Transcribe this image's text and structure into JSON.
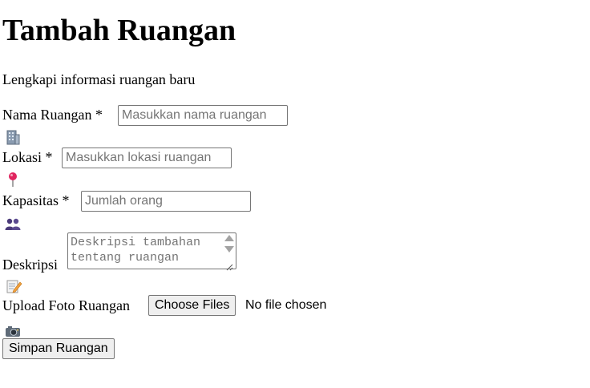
{
  "page": {
    "title": "Tambah Ruangan",
    "subtitle": "Lengkapi informasi ruangan baru"
  },
  "form": {
    "name": {
      "label": "Nama Ruangan *",
      "placeholder": "Masukkan nama ruangan",
      "value": "",
      "icon": "building-icon"
    },
    "location": {
      "label": "Lokasi *",
      "placeholder": "Masukkan lokasi ruangan",
      "value": "",
      "icon": "map-pin-icon"
    },
    "capacity": {
      "label": "Kapasitas *",
      "placeholder": "Jumlah orang",
      "value": "",
      "icon": "people-icon"
    },
    "description": {
      "label": "Deskripsi",
      "placeholder": "Deskripsi tambahan tentang ruangan",
      "value": "",
      "icon": "memo-icon"
    },
    "photo": {
      "label": "Upload Foto Ruangan",
      "button_label": "Choose Files",
      "status": "No file chosen",
      "icon": "camera-icon"
    },
    "submit_label": "Simpan Ruangan"
  }
}
